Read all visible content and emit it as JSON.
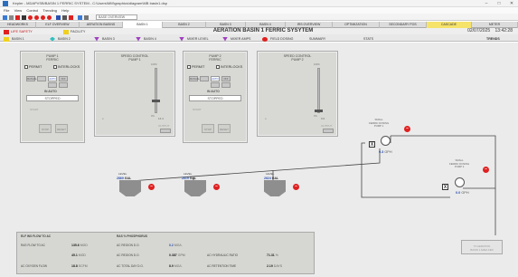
{
  "window": {
    "title": "Kepler - MDAPVSB/BASIN 1 FERRIC SYSTEM - C:\\Users\\MM\\graphics\\diagram\\MB basin1.dsp",
    "controls": [
      "–",
      "□",
      "✕"
    ]
  },
  "menu": [
    "File",
    "View",
    "Control",
    "Trending",
    "Help"
  ],
  "toolbar": {
    "select_value": "BASE OVERVIEW"
  },
  "nav_tabs": [
    {
      "label": "HEADWORKS"
    },
    {
      "label": "ELF OVERVIEW"
    },
    {
      "label": "AERATION BASINS"
    },
    {
      "label": "BASN 1"
    },
    {
      "label": "BASN 2"
    },
    {
      "label": "BASN 3"
    },
    {
      "label": "BASN 4"
    },
    {
      "label": "IRS OVERVIEW"
    },
    {
      "label": "OPTIMIZATION"
    },
    {
      "label": "SECONDARY POS"
    },
    {
      "label": "CASCADE"
    },
    {
      "label": "METER"
    }
  ],
  "alarms": {
    "life_safety": "LIFE SAFETY",
    "facility": "FACILITY"
  },
  "header": {
    "title": "AERATION BASIN 1 FERRIC SYSYTEM",
    "date": "02/07/2025",
    "time": "13:42:28"
  },
  "basins": [
    {
      "label": "BASIN 1",
      "color": "#f0d020"
    },
    {
      "label": "BASIN 2",
      "color": "#30c0c0"
    },
    {
      "label": "BASIN 3",
      "color": "#a040c0"
    },
    {
      "label": "BASIN 4",
      "color": "#a040c0"
    },
    {
      "label": "MIXER LEVEL",
      "color": "#a040c0"
    },
    {
      "label": "MIXER AMPS",
      "color": "#a040c0"
    },
    {
      "label": "FIELD DOSING",
      "color": "#e02020"
    },
    {
      "label": "SUMMARY",
      "color": ""
    },
    {
      "label": "STATS",
      "color": ""
    },
    {
      "label": "TRENDS",
      "color": ""
    }
  ],
  "pump_panels": [
    {
      "title": "PUMP 1\nFERRIC",
      "perm_label": "PERMIT",
      "interlock_label": "INTERLOCKS",
      "modes": [
        "MANUAL",
        "AUTO",
        "OFF"
      ],
      "selected_mode": "AUTO",
      "mode_text": "IN AUTO",
      "state": "STOPPED",
      "start_label": "START",
      "stop_label": "STOP",
      "reset_label": "RESET"
    },
    {
      "title": "PUMP 2\nFERRIC",
      "perm_label": "PERMIT",
      "interlock_label": "INTERLOCKS",
      "modes": [
        "MANUAL",
        "AUTO",
        "OFF"
      ],
      "selected_mode": "AUTO",
      "mode_text": "IN AUTO",
      "state": "STOPPED",
      "start_label": "START",
      "stop_label": "STOP",
      "reset_label": "RESET"
    }
  ],
  "speed_panels": [
    {
      "title": "SPEED CONTROL\nPUMP 1",
      "max": "100%",
      "min": "0%",
      "value": "14.4",
      "output_label": "OUTPUT"
    },
    {
      "title": "SPEED CONTROL\nPUMP 2",
      "max": "100%",
      "min": "0%",
      "value": "0.0",
      "output_label": "OUTPUT"
    }
  ],
  "tanks": [
    {
      "title": "LEVEL",
      "value": "2869",
      "unit": "GAL"
    },
    {
      "title": "LEVEL",
      "value": "2619",
      "unit": "GAL"
    },
    {
      "title": "LEVEL",
      "value": "2624",
      "unit": "GAL"
    }
  ],
  "pumps": [
    {
      "label": "SMALL\nFERRIC DOSING\nPUMP 1",
      "value": "0.3",
      "unit": "GPH",
      "x_label": "X"
    },
    {
      "label": "SMALL\nFERRIC DOSING\nPUMP 2",
      "value": "0.0",
      "unit": "GPH",
      "x_label": "X"
    }
  ],
  "destination": "TO AERATION\nBASIN 1 AREA FED",
  "stats": {
    "header_left": "ELF INS FLOW TO AC",
    "header_right": "RAS % PHOSPHORUS",
    "rows": [
      {
        "label": "RAS FLOW TO AC",
        "value": "135.6",
        "unit": "MGD",
        "label2": "AC REGION D.O.",
        "value2": "0.2",
        "unit2": "MG/L",
        "label3": "",
        "value3": "",
        "unit3": ""
      },
      {
        "label": "",
        "value": "45.1",
        "unit": "MGD",
        "label2": "AC REGION D.O.",
        "value2": "0.387",
        "unit2": "GPM",
        "label3": "AC HYDRAULIC RATIO",
        "value3": "71.31",
        "unit3": "%"
      },
      {
        "label": "AC OXYGEN FLOW",
        "value": "18.8",
        "unit": "SCFM",
        "label2": "AC TOTAL DAY D.O.",
        "value2": "8.9",
        "unit2": "MG/L",
        "label3": "AC RETENTION TIME",
        "value3": "2.19",
        "unit3": "DAYS"
      }
    ]
  },
  "colors": {
    "accent_blue": "#2a4fb0",
    "alarm_red": "#e02020",
    "nav_yellow": "#f5e36a",
    "tank_gray": "#8e8e8e"
  }
}
